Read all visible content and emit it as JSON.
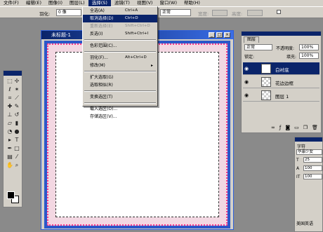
{
  "menubar": [
    "文件(F)",
    "编辑(E)",
    "图像(I)",
    "图层(L)",
    "选择(S)",
    "滤镜(T)",
    "视图(V)",
    "窗口(W)",
    "帮助(H)"
  ],
  "options": {
    "feather_label": "羽化:",
    "feather_value": "0 像",
    "style_value": "正常",
    "width_label": "宽度:",
    "height_label": "高度:"
  },
  "document": {
    "title": "未标题-1"
  },
  "select_menu": [
    {
      "label": "全选(A)",
      "shortcut": "Ctrl+A",
      "state": "normal"
    },
    {
      "label": "取消选择(D)",
      "shortcut": "Ctrl+D",
      "state": "highlight"
    },
    {
      "label": "重新选择(E)",
      "shortcut": "Shift+Ctrl+D",
      "state": "disabled"
    },
    {
      "label": "反选(I)",
      "shortcut": "Shift+Ctrl+I",
      "state": "normal"
    },
    {
      "sep": true
    },
    {
      "label": "色彩范围(C)...",
      "shortcut": "",
      "state": "normal"
    },
    {
      "sep": true
    },
    {
      "label": "羽化(F)...",
      "shortcut": "Alt+Ctrl+D",
      "state": "normal"
    },
    {
      "label": "修改(M)",
      "shortcut": "",
      "state": "normal",
      "submenu": true
    },
    {
      "sep": true
    },
    {
      "label": "扩大选取(G)",
      "shortcut": "",
      "state": "normal"
    },
    {
      "label": "选取相似(R)",
      "shortcut": "",
      "state": "normal"
    },
    {
      "sep": true
    },
    {
      "label": "变换选区(T)",
      "shortcut": "",
      "state": "normal"
    },
    {
      "sep": true
    },
    {
      "label": "载入选区(O)...",
      "shortcut": "",
      "state": "normal"
    },
    {
      "label": "存储选区(V)...",
      "shortcut": "",
      "state": "normal"
    }
  ],
  "layers_panel": {
    "tab": "图层",
    "blend_mode": "正常",
    "opacity_label": "不透明度:",
    "opacity_value": "100%",
    "lock_label": "锁定:",
    "fill_label": "填充:",
    "fill_value": "100%",
    "layers": [
      {
        "name": "白衬底",
        "active": true,
        "thumb": "white"
      },
      {
        "name": "花边边框",
        "active": false,
        "thumb": "check"
      },
      {
        "name": "图层 1",
        "active": false,
        "thumb": "check"
      }
    ]
  },
  "char_panel": {
    "tab": "字符",
    "font": "华康少女",
    "size": "25",
    "lead": "100",
    "scale": "100",
    "lang": "美国英语"
  }
}
